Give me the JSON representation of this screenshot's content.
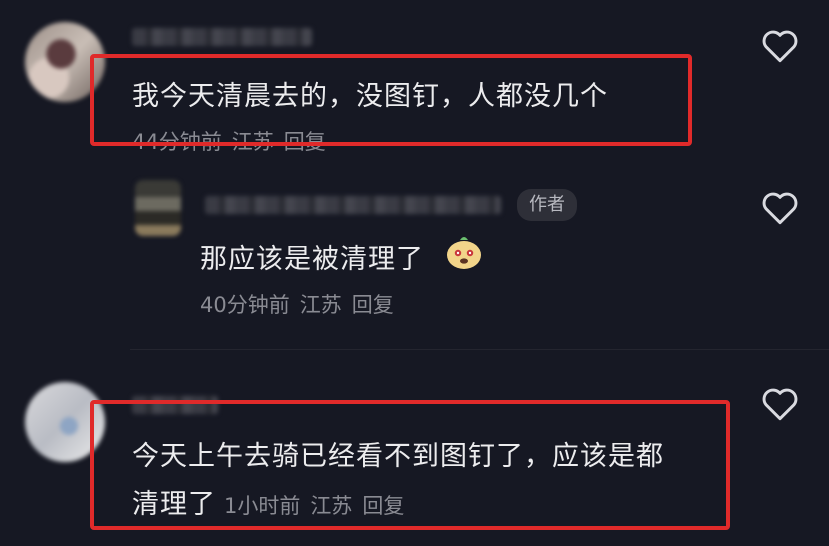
{
  "comments": [
    {
      "text": "我今天清晨去的，没图钉，人都没几个",
      "time": "44分钟前",
      "location": "江苏",
      "reply": "回复"
    },
    {
      "author_tag": "作者",
      "text": "那应该是被清理了",
      "time": "40分钟前",
      "location": "江苏",
      "reply": "回复"
    },
    {
      "text_line1": "今天上午去骑已经看不到图钉了，应该是都",
      "text_line2": "清理了",
      "time": "1小时前",
      "location": "江苏",
      "reply": "回复"
    }
  ],
  "colors": {
    "background": "#161823",
    "highlight_box": "#e02a2a",
    "meta_text": "#8a8b93"
  },
  "icons": [
    "heart-outline-icon",
    "smiling-face-emoji"
  ]
}
